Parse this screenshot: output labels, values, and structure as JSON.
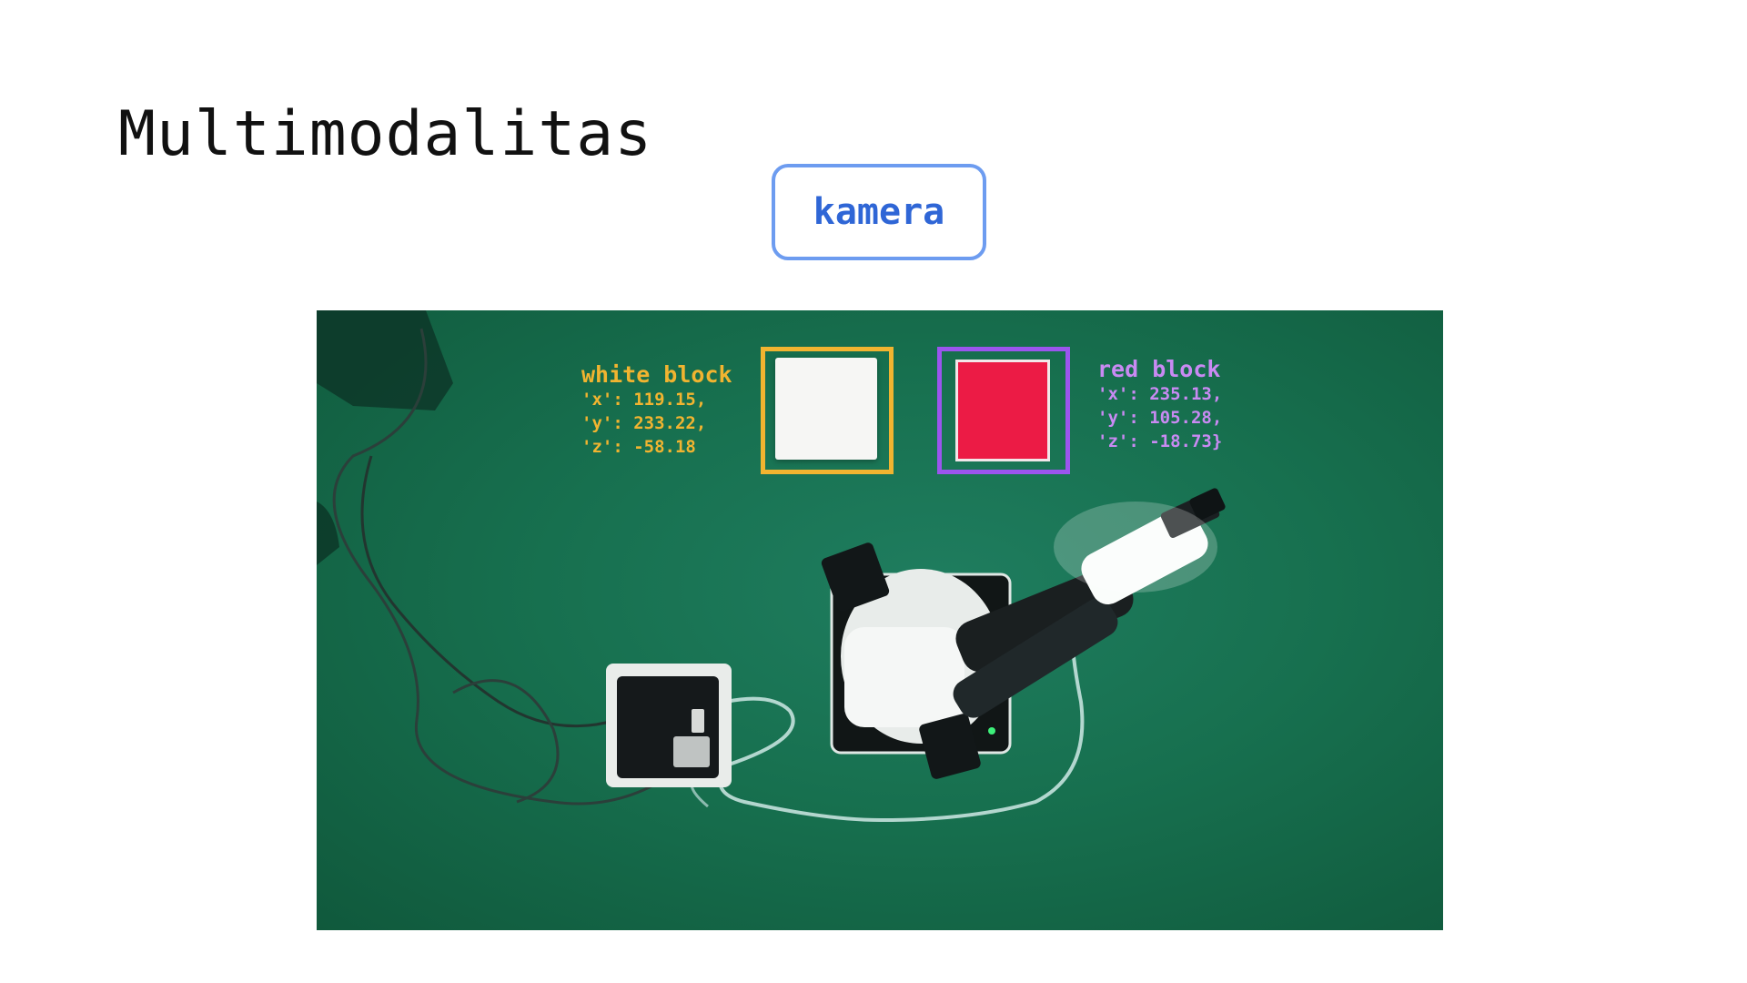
{
  "slide": {
    "title": "Multimodalitas",
    "camera_label": "kamera"
  },
  "detections": [
    {
      "name": "white block",
      "x_line": "'x': 119.15,",
      "y_line": "'y': 233.22,",
      "z_line": "'z': -58.18",
      "color": "#f1b430"
    },
    {
      "name": "red block",
      "x_line": "'x': 235.13,",
      "y_line": "'y': 105.28,",
      "z_line": "'z': -18.73}",
      "color": "#9b55ee"
    }
  ],
  "colors": {
    "accent": "#2f66d6",
    "mat": "#17704f"
  }
}
